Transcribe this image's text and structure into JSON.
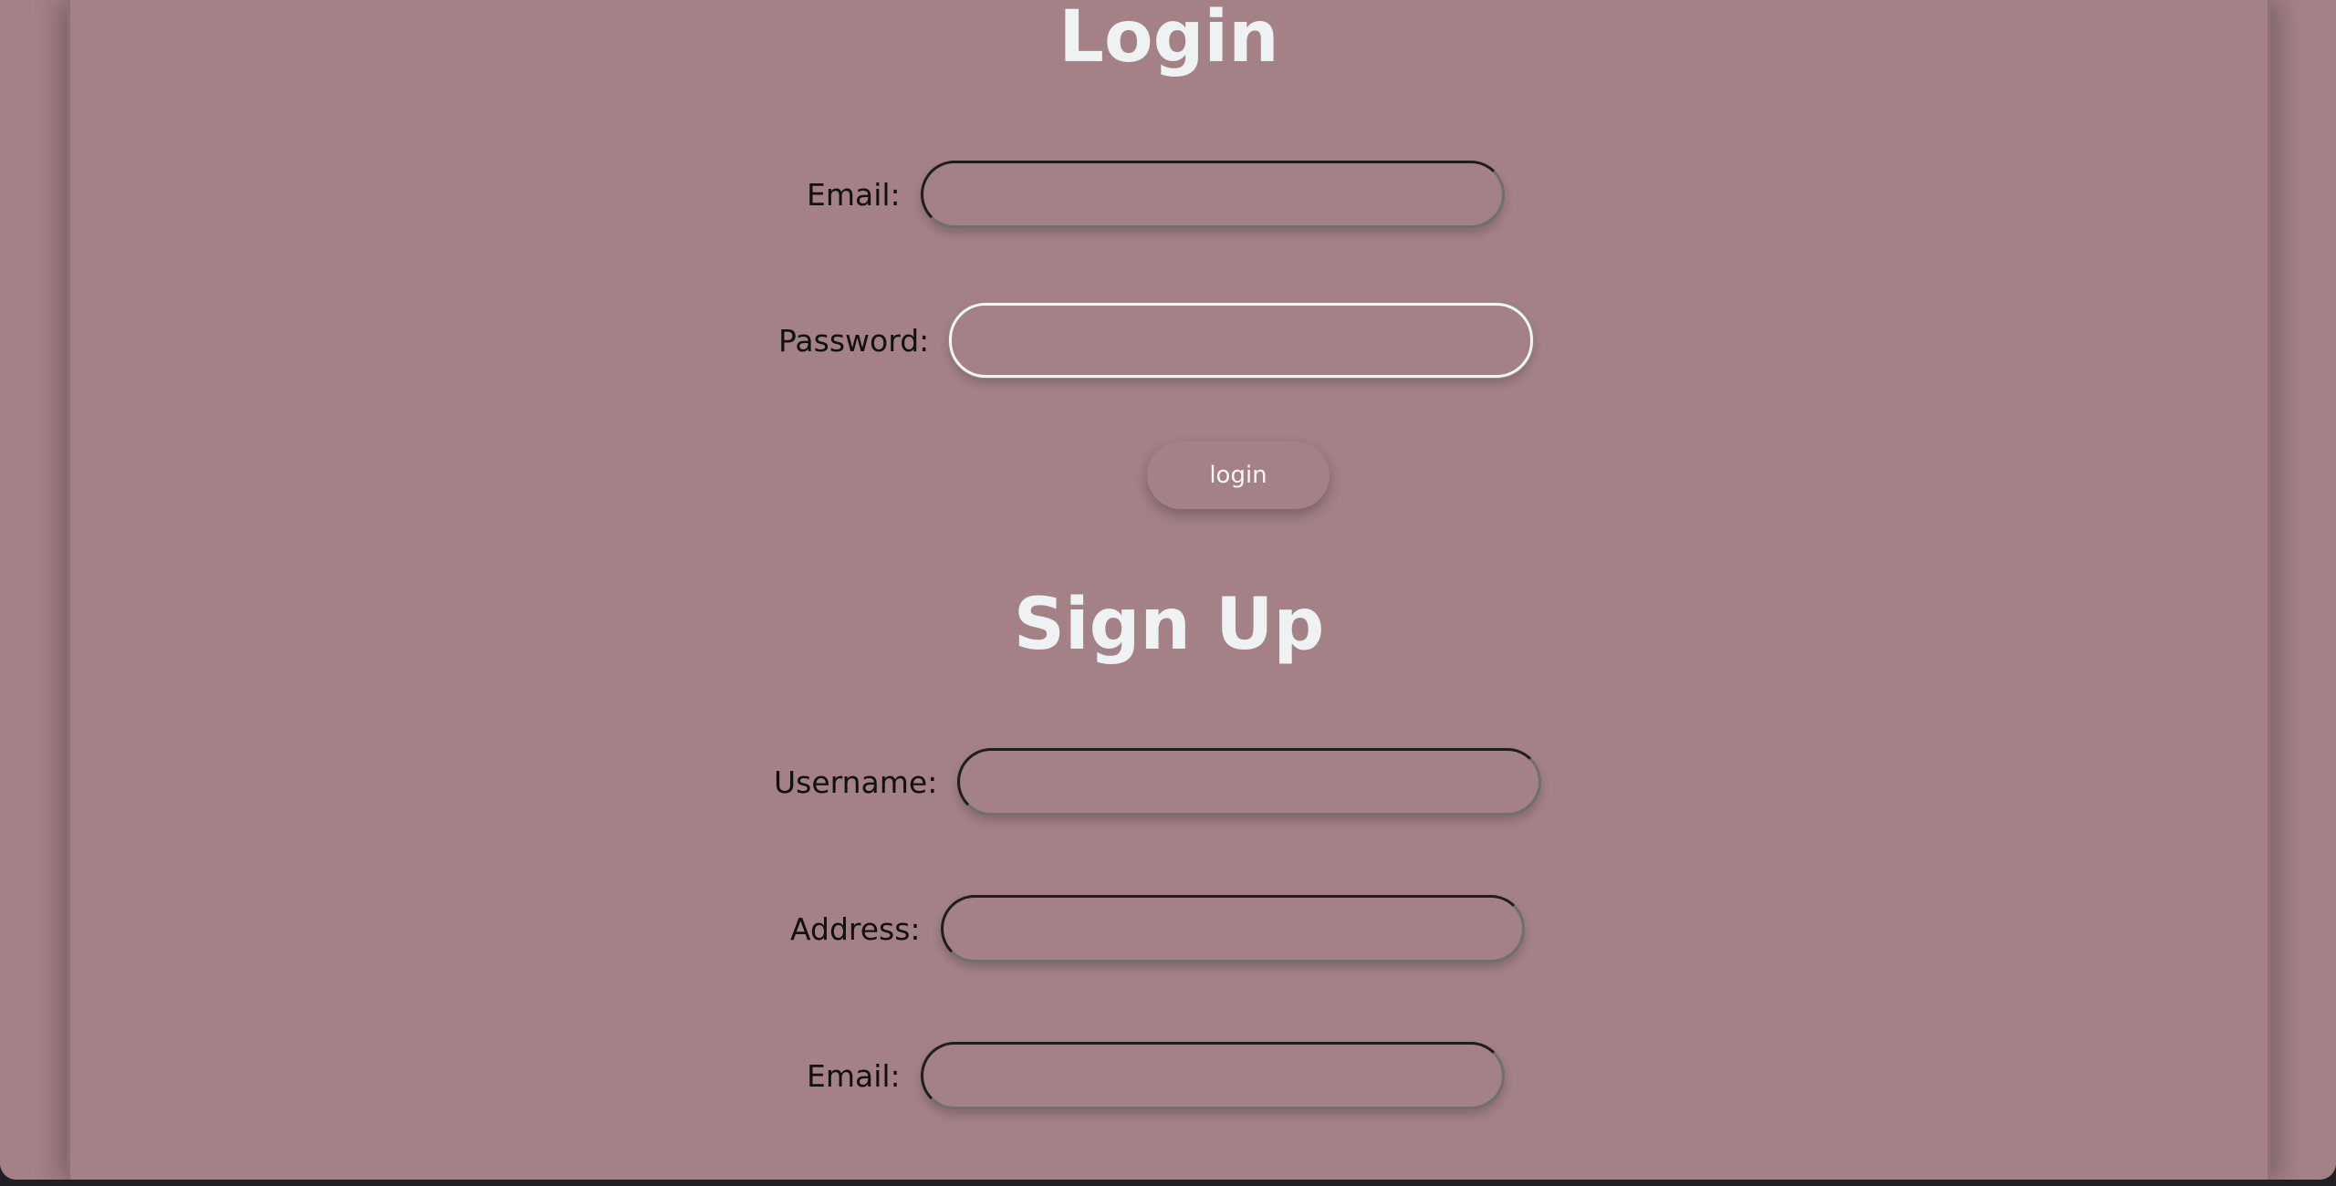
{
  "login": {
    "title": "Login",
    "email_label": "Email:",
    "email_value": "",
    "password_label": "Password:",
    "password_value": "",
    "submit_label": "login"
  },
  "signup": {
    "title": "Sign Up",
    "username_label": "Username:",
    "username_value": "",
    "address_label": "Address:",
    "address_value": "",
    "email_label": "Email:",
    "email_value": ""
  },
  "colors": {
    "background": "#a38186",
    "heading": "#eef2f2",
    "label": "#111111"
  }
}
